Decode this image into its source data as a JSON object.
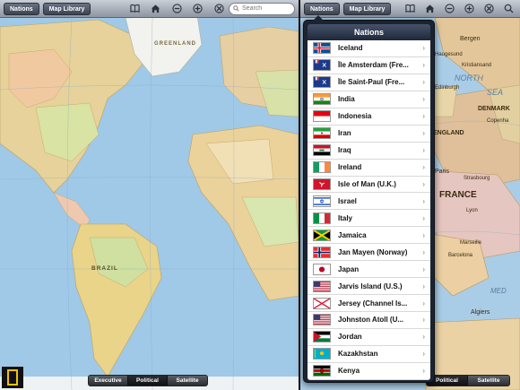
{
  "toolbar": {
    "nations_label": "Nations",
    "map_library_label": "Map Library",
    "search_placeholder": "Search"
  },
  "left_map_labels": [
    "GREENLAND",
    "BRAZIL"
  ],
  "right_map_labels": [
    "Bergen",
    "Haugesund",
    "NORTH",
    "SEA",
    "DENMARK",
    "Copenha",
    "ENGLAND",
    "Paris",
    "Strasbourg",
    "FRANCE",
    "Lyon",
    "Marseille",
    "Barcelona",
    "Algiers",
    "MED",
    "Kristiansand",
    "Edinburgh"
  ],
  "map_modes": [
    "Executive",
    "Political",
    "Satellite"
  ],
  "active_mode": "Political",
  "popover": {
    "title": "Nations",
    "items": [
      {
        "name": "Iceland",
        "flag": "iceland"
      },
      {
        "name": "Île Amsterdam (Fre...",
        "flag": "french-territory"
      },
      {
        "name": "Île Saint-Paul (Fre...",
        "flag": "french-territory"
      },
      {
        "name": "India",
        "flag": "india"
      },
      {
        "name": "Indonesia",
        "flag": "indonesia"
      },
      {
        "name": "Iran",
        "flag": "iran"
      },
      {
        "name": "Iraq",
        "flag": "iraq"
      },
      {
        "name": "Ireland",
        "flag": "ireland"
      },
      {
        "name": "Isle of Man (U.K.)",
        "flag": "isle-of-man"
      },
      {
        "name": "Israel",
        "flag": "israel"
      },
      {
        "name": "Italy",
        "flag": "italy"
      },
      {
        "name": "Jamaica",
        "flag": "jamaica"
      },
      {
        "name": "Jan Mayen (Norway)",
        "flag": "norway"
      },
      {
        "name": "Japan",
        "flag": "japan"
      },
      {
        "name": "Jarvis Island (U.S.)",
        "flag": "usa"
      },
      {
        "name": "Jersey (Channel Is...",
        "flag": "jersey"
      },
      {
        "name": "Johnston Atoll (U...",
        "flag": "usa"
      },
      {
        "name": "Jordan",
        "flag": "jordan"
      },
      {
        "name": "Kazakhstan",
        "flag": "kazakhstan"
      },
      {
        "name": "Kenya",
        "flag": "kenya"
      }
    ]
  },
  "colors": {
    "ocean": "#9fc9e6",
    "land": "#e8d9a8",
    "toolbar": "#a9b0bb"
  }
}
